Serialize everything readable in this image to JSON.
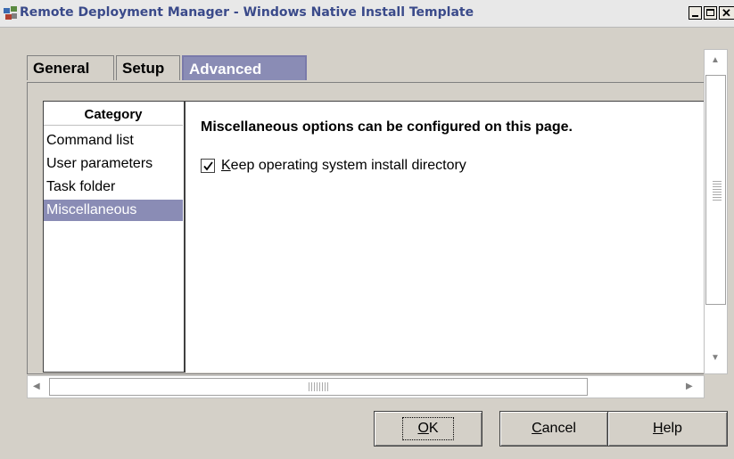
{
  "window": {
    "title": "Remote Deployment Manager - Windows Native Install Template",
    "icon": "rdm-app-icon",
    "controls": [
      "minimize",
      "maximize",
      "close"
    ]
  },
  "tabs": [
    {
      "label": "General",
      "selected": false
    },
    {
      "label": "Setup",
      "selected": false
    },
    {
      "label": "Advanced",
      "selected": true
    }
  ],
  "category": {
    "header": "Category",
    "items": [
      {
        "label": "Command list",
        "selected": false
      },
      {
        "label": "User parameters",
        "selected": false
      },
      {
        "label": "Task folder",
        "selected": false
      },
      {
        "label": "Miscellaneous",
        "selected": true
      }
    ]
  },
  "main": {
    "heading": "Miscellaneous options can be configured on this page.",
    "checkbox": {
      "label_mnemonic": "K",
      "label_rest": "eep operating system install directory",
      "checked": true
    }
  },
  "buttons": {
    "ok": {
      "mnemonic": "O",
      "rest": "K"
    },
    "cancel": {
      "mnemonic": "C",
      "rest": "ancel"
    },
    "help": {
      "mnemonic": "H",
      "rest": "elp"
    }
  },
  "colors": {
    "selection": "#8a8cb5",
    "title_text": "#3a4a8a",
    "dialog_bg": "#d4d0c8"
  }
}
